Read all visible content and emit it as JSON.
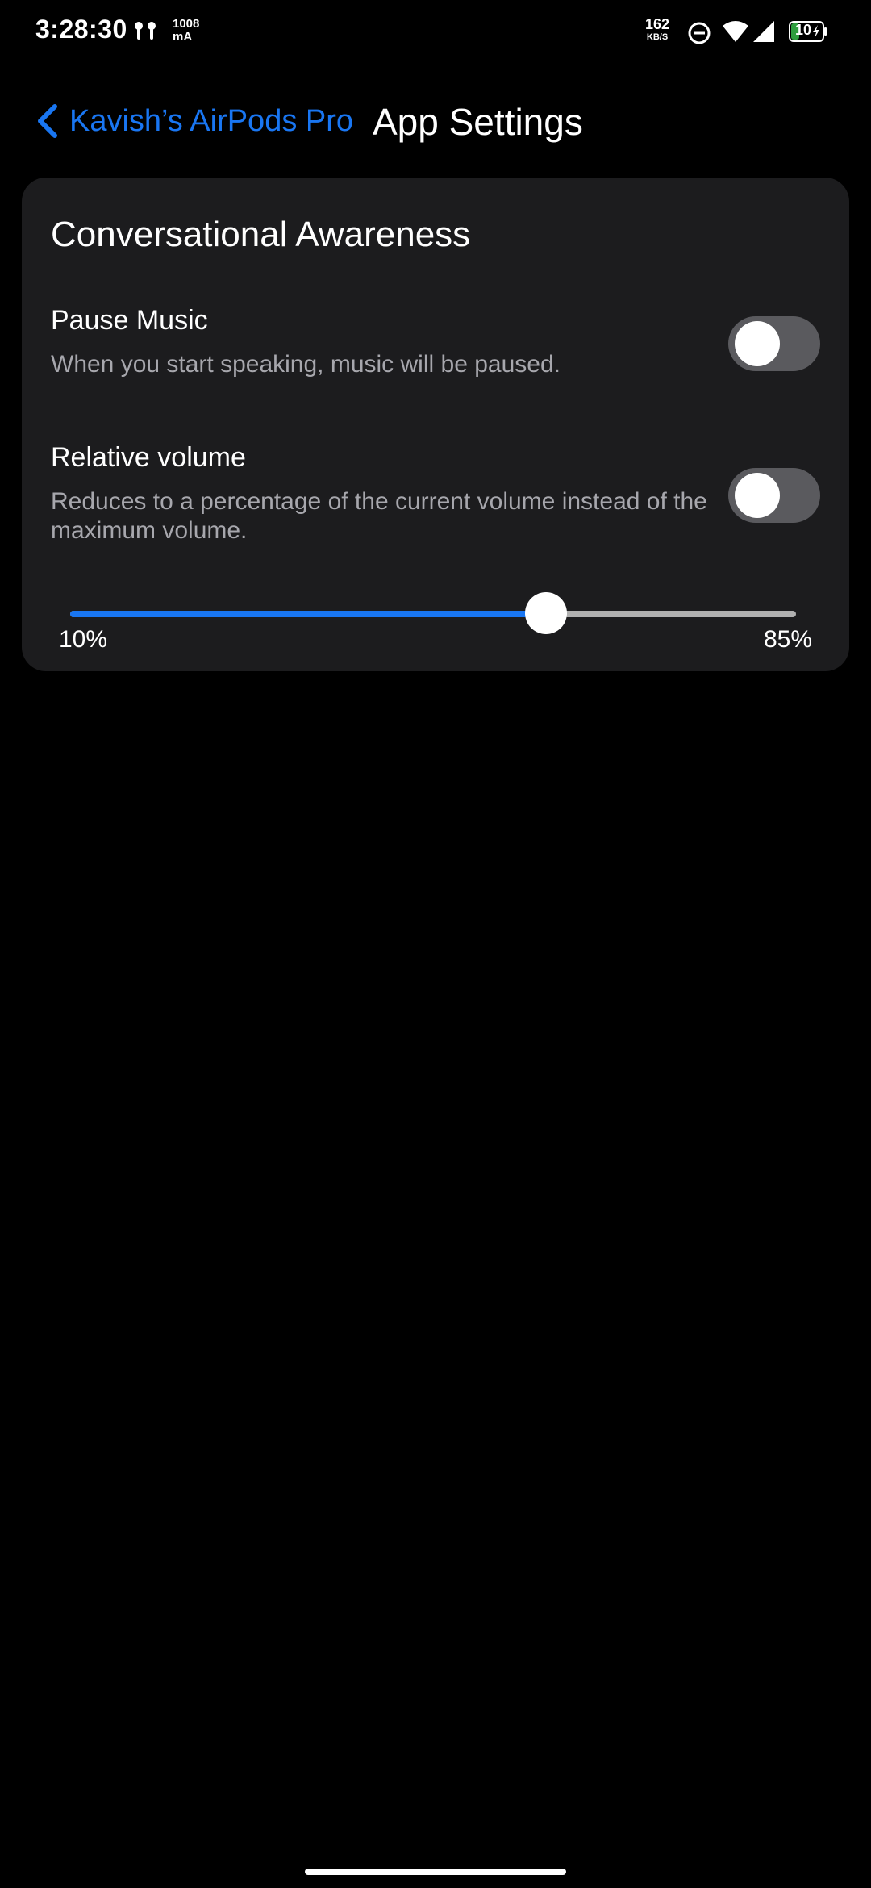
{
  "status_bar": {
    "time": "3:28:30",
    "current_value": "1008",
    "current_unit": "mA",
    "speed_value": "162",
    "speed_unit": "KB/S",
    "battery": "10",
    "icons": [
      "airpods-icon",
      "do-not-disturb-icon",
      "wifi-icon",
      "signal-icon",
      "battery-charging-icon"
    ]
  },
  "header": {
    "back_label": "Kavish’s AirPods Pro",
    "title": "App Settings"
  },
  "card": {
    "title": "Conversational Awareness",
    "pause_music": {
      "title": "Pause Music",
      "subtitle": "When you start speaking, music will be paused.",
      "enabled": false
    },
    "relative_volume": {
      "title": "Relative volume",
      "subtitle": "Reduces to a percentage of the current volume instead of the maximum volume.",
      "enabled": false
    },
    "slider": {
      "min_label": "10%",
      "max_label": "85%",
      "fraction": 0.655
    }
  },
  "colors": {
    "accent": "#1976f2",
    "card_bg": "#1c1c1e",
    "toggle_off": "#5a5a5e",
    "secondary_text": "#a7a7ad"
  }
}
